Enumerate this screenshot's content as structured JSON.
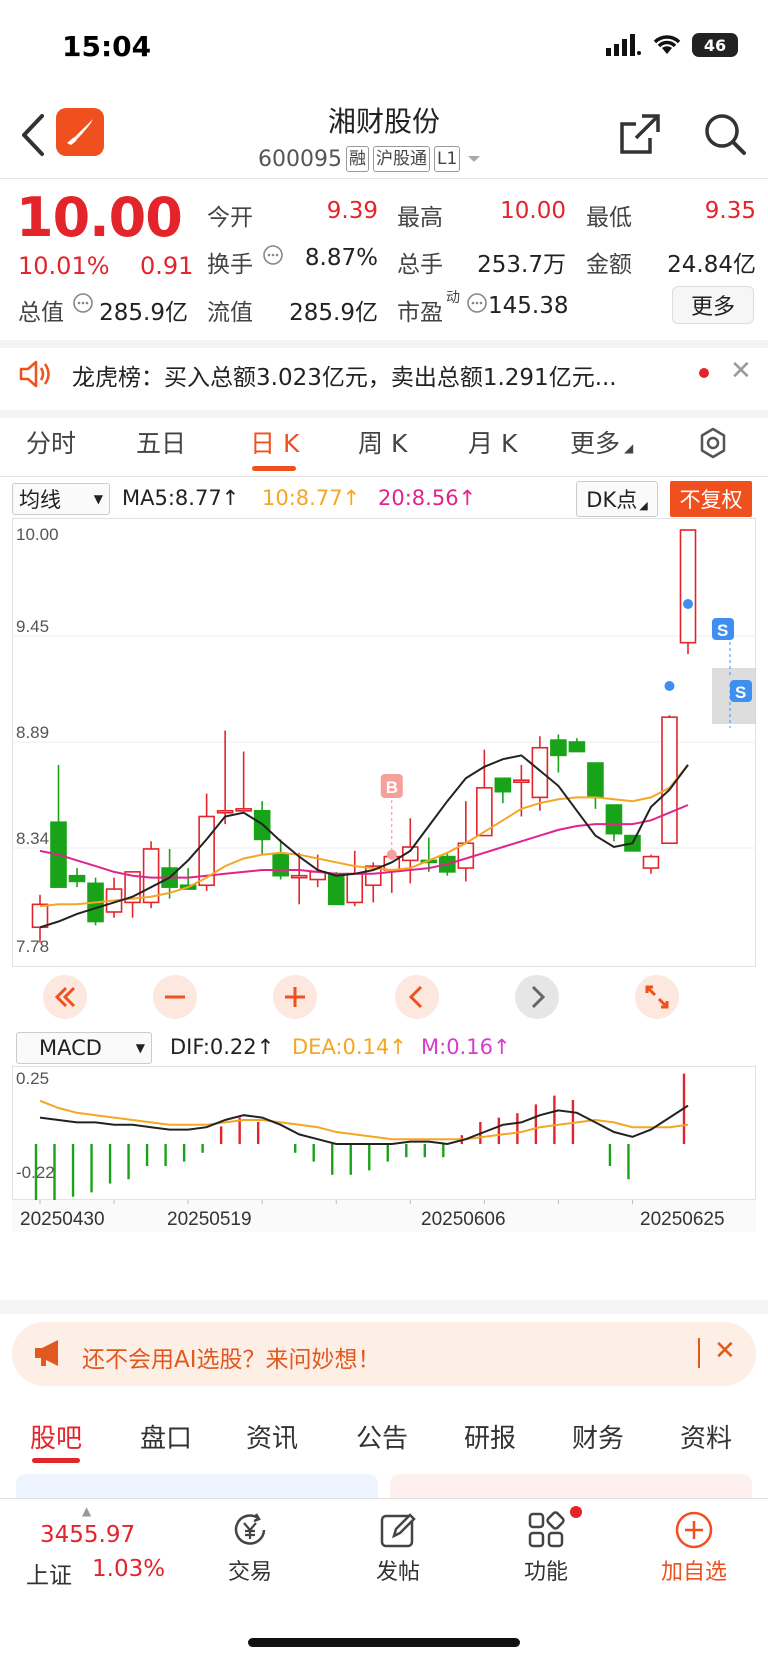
{
  "status": {
    "time": "15:04",
    "battery": "46"
  },
  "header": {
    "name": "湘财股份",
    "code": "600095",
    "tags": [
      "融",
      "沪股通",
      "L1"
    ]
  },
  "quote": {
    "price": "10.00",
    "change_pct": "10.01%",
    "change": "0.91",
    "open_label": "今开",
    "open": "9.39",
    "high_label": "最高",
    "high": "10.00",
    "low_label": "最低",
    "low": "9.35",
    "turnover_label": "换手",
    "turnover": "8.87%",
    "volume_label": "总手",
    "volume": "253.7万",
    "amount_label": "金额",
    "amount": "24.84亿",
    "mktcap_label": "总值",
    "mktcap": "285.9亿",
    "float_label": "流值",
    "float": "285.9亿",
    "pe_label": "市盈",
    "pe_sup": "动",
    "pe": "145.38",
    "more": "更多"
  },
  "dragon": {
    "text": "龙虎榜：买入总额3.023亿元，卖出总额1.291亿元..."
  },
  "chart_tabs": [
    "分时",
    "五日",
    "日 K",
    "周 K",
    "月 K",
    "更多"
  ],
  "chart_tabs_active": "日 K",
  "indicators": {
    "ma_select": "均线",
    "ma5": "MA5:8.77↑",
    "ma10": "10:8.77↑",
    "ma20": "20:8.56↑",
    "dk": "DK点",
    "fuquan": "不复权",
    "macd_select": "MACD",
    "dif": "DIF:0.22↑",
    "dea": "DEA:0.14↑",
    "m": "M:0.16↑",
    "colors": {
      "ma5": "#222222",
      "ma10": "#f5a623",
      "ma20": "#e0248b",
      "up": "#e4242b",
      "down": "#19a319"
    }
  },
  "chart_data": {
    "type": "candlestick",
    "y_ticks": [
      "10.00",
      "9.45",
      "8.89",
      "8.34",
      "7.78"
    ],
    "ylim": [
      7.78,
      10.0
    ],
    "x_labels": [
      "20250430",
      "20250519",
      "20250606",
      "20250625"
    ],
    "candles": [
      {
        "o": 7.92,
        "h": 8.09,
        "l": 7.84,
        "c": 8.04
      },
      {
        "o": 8.47,
        "h": 8.77,
        "l": 8.3,
        "c": 8.13
      },
      {
        "o": 8.19,
        "h": 8.23,
        "l": 8.13,
        "c": 8.16
      },
      {
        "o": 8.15,
        "h": 8.18,
        "l": 7.93,
        "c": 7.95
      },
      {
        "o": 8.0,
        "h": 8.18,
        "l": 7.97,
        "c": 8.12
      },
      {
        "o": 8.05,
        "h": 8.21,
        "l": 7.97,
        "c": 8.21
      },
      {
        "o": 8.05,
        "h": 8.37,
        "l": 8.02,
        "c": 8.33
      },
      {
        "o": 8.23,
        "h": 8.33,
        "l": 8.07,
        "c": 8.13
      },
      {
        "o": 8.14,
        "h": 8.23,
        "l": 8.13,
        "c": 8.12
      },
      {
        "o": 8.14,
        "h": 8.62,
        "l": 8.11,
        "c": 8.5
      },
      {
        "o": 8.53,
        "h": 8.95,
        "l": 8.46,
        "c": 8.53
      },
      {
        "o": 8.54,
        "h": 8.84,
        "l": 8.53,
        "c": 8.54
      },
      {
        "o": 8.53,
        "h": 8.58,
        "l": 8.3,
        "c": 8.38
      },
      {
        "o": 8.3,
        "h": 8.38,
        "l": 8.17,
        "c": 8.19
      },
      {
        "o": 8.19,
        "h": 8.31,
        "l": 8.04,
        "c": 8.19
      },
      {
        "o": 8.17,
        "h": 8.3,
        "l": 8.13,
        "c": 8.21
      },
      {
        "o": 8.2,
        "h": 8.21,
        "l": 8.04,
        "c": 8.04
      },
      {
        "o": 8.05,
        "h": 8.32,
        "l": 8.03,
        "c": 8.2
      },
      {
        "o": 8.14,
        "h": 8.26,
        "l": 8.05,
        "c": 8.24
      },
      {
        "o": 8.22,
        "h": 8.3,
        "l": 8.1,
        "c": 8.29
      },
      {
        "o": 8.27,
        "h": 8.49,
        "l": 8.15,
        "c": 8.34
      },
      {
        "o": 8.27,
        "h": 8.39,
        "l": 8.21,
        "c": 8.26
      },
      {
        "o": 8.29,
        "h": 8.31,
        "l": 8.19,
        "c": 8.21
      },
      {
        "o": 8.23,
        "h": 8.58,
        "l": 8.16,
        "c": 8.36
      },
      {
        "o": 8.4,
        "h": 8.85,
        "l": 8.4,
        "c": 8.65
      },
      {
        "o": 8.7,
        "h": 8.7,
        "l": 8.57,
        "c": 8.63
      },
      {
        "o": 8.69,
        "h": 8.77,
        "l": 8.5,
        "c": 8.69
      },
      {
        "o": 8.6,
        "h": 8.92,
        "l": 8.53,
        "c": 8.86
      },
      {
        "o": 8.9,
        "h": 8.93,
        "l": 8.73,
        "c": 8.82
      },
      {
        "o": 8.89,
        "h": 8.91,
        "l": 8.86,
        "c": 8.84
      },
      {
        "o": 8.78,
        "h": 8.78,
        "l": 8.54,
        "c": 8.6
      },
      {
        "o": 8.56,
        "h": 8.56,
        "l": 8.37,
        "c": 8.41
      },
      {
        "o": 8.4,
        "h": 8.4,
        "l": 8.32,
        "c": 8.32
      },
      {
        "o": 8.23,
        "h": 8.3,
        "l": 8.2,
        "c": 8.29
      },
      {
        "o": 8.36,
        "h": 9.03,
        "l": 8.36,
        "c": 9.02
      },
      {
        "o": 9.41,
        "h": 10.0,
        "l": 9.35,
        "c": 10.0
      }
    ],
    "ma5": [
      7.92,
      7.95,
      7.99,
      8.02,
      8.05,
      8.08,
      8.13,
      8.18,
      8.27,
      8.38,
      8.5,
      8.52,
      8.46,
      8.37,
      8.29,
      8.22,
      8.19,
      8.2,
      8.22,
      8.26,
      8.32,
      8.45,
      8.58,
      8.7,
      8.76,
      8.8,
      8.82,
      8.74,
      8.66,
      8.53,
      8.4,
      8.34,
      8.36,
      8.55,
      8.64,
      8.77
    ],
    "ma10": [
      8.03,
      8.04,
      8.04,
      8.05,
      8.06,
      8.07,
      8.08,
      8.1,
      8.13,
      8.18,
      8.24,
      8.28,
      8.3,
      8.31,
      8.3,
      8.28,
      8.26,
      8.24,
      8.23,
      8.22,
      8.23,
      8.27,
      8.31,
      8.36,
      8.42,
      8.48,
      8.54,
      8.57,
      8.59,
      8.6,
      8.6,
      8.59,
      8.58,
      8.6,
      8.65,
      8.77
    ],
    "ma20": [
      8.32,
      8.3,
      8.27,
      8.24,
      8.21,
      8.19,
      8.18,
      8.18,
      8.18,
      8.19,
      8.2,
      8.21,
      8.22,
      8.22,
      8.22,
      8.21,
      8.2,
      8.2,
      8.2,
      8.21,
      8.22,
      8.23,
      8.25,
      8.28,
      8.31,
      8.34,
      8.37,
      8.4,
      8.43,
      8.45,
      8.46,
      8.46,
      8.46,
      8.48,
      8.52,
      8.56
    ],
    "macd": {
      "ylim": [
        -0.22,
        0.25
      ],
      "y_ticks": [
        "0.25",
        "-0.22"
      ],
      "dif": [
        0.17,
        0.16,
        0.15,
        0.15,
        0.14,
        0.14,
        0.13,
        0.12,
        0.12,
        0.13,
        0.16,
        0.18,
        0.17,
        0.14,
        0.1,
        0.08,
        0.06,
        0.06,
        0.06,
        0.06,
        0.07,
        0.07,
        0.06,
        0.08,
        0.11,
        0.14,
        0.15,
        0.18,
        0.2,
        0.19,
        0.15,
        0.11,
        0.09,
        0.12,
        0.17,
        0.22
      ],
      "dea": [
        0.24,
        0.21,
        0.19,
        0.18,
        0.17,
        0.16,
        0.15,
        0.14,
        0.14,
        0.14,
        0.15,
        0.16,
        0.16,
        0.15,
        0.14,
        0.13,
        0.11,
        0.1,
        0.09,
        0.08,
        0.08,
        0.08,
        0.08,
        0.08,
        0.09,
        0.1,
        0.11,
        0.13,
        0.14,
        0.15,
        0.16,
        0.15,
        0.13,
        0.13,
        0.13,
        0.14
      ],
      "m": [
        -0.2,
        -0.16,
        -0.12,
        -0.11,
        -0.09,
        -0.08,
        -0.05,
        -0.05,
        -0.04,
        -0.02,
        0.04,
        0.06,
        0.05,
        0.0,
        -0.02,
        -0.04,
        -0.07,
        -0.07,
        -0.06,
        -0.04,
        -0.03,
        -0.03,
        -0.03,
        0.02,
        0.05,
        0.06,
        0.07,
        0.09,
        0.11,
        0.1,
        0.0,
        -0.05,
        -0.08,
        0.0,
        0.0,
        0.16
      ]
    }
  },
  "ai_banner": {
    "text": "还不会用AI选股？来问妙想！"
  },
  "bottom_tabs": [
    "股吧",
    "盘口",
    "资讯",
    "公告",
    "研报",
    "财务",
    "资料"
  ],
  "bottom_nav": {
    "index_value": "3455.97",
    "index_name": "上证",
    "index_pct": "1.03%",
    "trade": "交易",
    "post": "发帖",
    "func": "功能",
    "add": "加自选"
  }
}
